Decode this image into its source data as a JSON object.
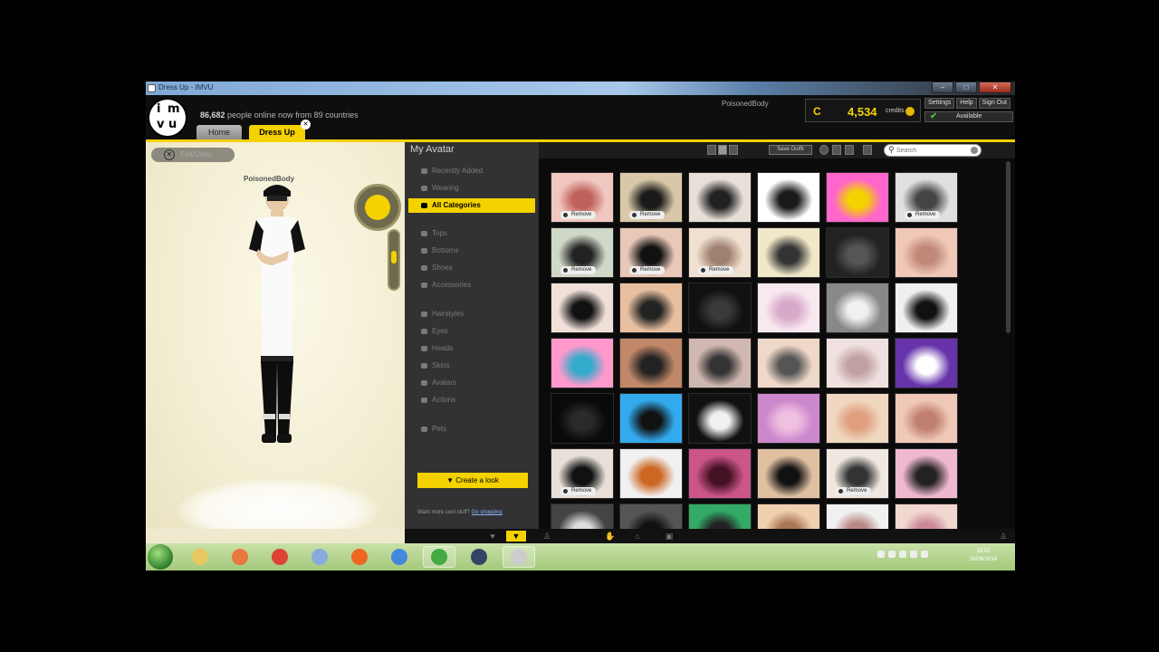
{
  "window": {
    "title": "Dress Up - IMVU"
  },
  "header": {
    "logo_letters": [
      "i",
      "m",
      "v",
      "u"
    ],
    "online_count": "86,682",
    "online_text": "people online now from 89 countries",
    "username": "PoisonedBody",
    "credits_value": "4,534",
    "credits_label": "credits",
    "links": [
      "Settings",
      "Help",
      "Sign Out"
    ],
    "status": "Available",
    "tabs": [
      {
        "label": "Home"
      },
      {
        "label": "Dress Up"
      }
    ],
    "accent_color": "#f3d200"
  },
  "avatar_view": {
    "back_label": "Exit/Undo",
    "avatar_name": "PoisonedBody"
  },
  "categories": {
    "title": "My Avatar",
    "items": [
      {
        "label": "Recently Added",
        "icon": "clock-icon"
      },
      {
        "label": "Wearing",
        "icon": "shirt-icon"
      },
      {
        "label": "All Categories",
        "icon": "grid-icon",
        "selected": true
      },
      {
        "label": "Tops",
        "icon": "shirt-icon"
      },
      {
        "label": "Bottoms",
        "icon": "pants-icon"
      },
      {
        "label": "Shoes",
        "icon": "shoe-icon"
      },
      {
        "label": "Accessories",
        "icon": "accessory-icon"
      },
      {
        "label": "Hairstyles",
        "icon": "hair-icon"
      },
      {
        "label": "Eyes",
        "icon": "eye-icon"
      },
      {
        "label": "Heads",
        "icon": "head-icon"
      },
      {
        "label": "Skins",
        "icon": "skin-icon"
      },
      {
        "label": "Avatars",
        "icon": "avatar-icon"
      },
      {
        "label": "Actions",
        "icon": "action-icon"
      },
      {
        "label": "Pets",
        "icon": "pet-icon"
      }
    ],
    "shop_note": "Want more cool stuff?",
    "shop_link": "Go shopping",
    "create_button": "Create a look"
  },
  "toolbar": {
    "save_outfit": "Save Outfit",
    "search_placeholder": "Search"
  },
  "products": {
    "remove_label": "Remove",
    "tiles": [
      {
        "colors": [
          "#f0c8c0",
          "#c0605a"
        ],
        "remove": true
      },
      {
        "colors": [
          "#d8c8a8",
          "#1a1a1a"
        ],
        "remove": true
      },
      {
        "colors": [
          "#e8e0d8",
          "#222222"
        ],
        "remove": false
      },
      {
        "colors": [
          "#ffffff",
          "#1a1a1a"
        ],
        "remove": false
      },
      {
        "colors": [
          "#ff66cc",
          "#f3d200"
        ],
        "remove": false
      },
      {
        "colors": [
          "#e0e0e0",
          "#444444"
        ],
        "remove": true
      },
      {
        "colors": [
          "#d0d8c8",
          "#222222"
        ],
        "remove": true
      },
      {
        "colors": [
          "#e8c8b8",
          "#111111"
        ],
        "remove": true
      },
      {
        "colors": [
          "#f0e0d0",
          "#a08070"
        ],
        "remove": true
      },
      {
        "colors": [
          "#f0e8c8",
          "#333333"
        ],
        "remove": false
      },
      {
        "colors": [
          "#222222",
          "#555555"
        ],
        "remove": false
      },
      {
        "colors": [
          "#f0c8b8",
          "#c08878"
        ],
        "remove": false
      },
      {
        "colors": [
          "#f0e0d8",
          "#111111"
        ],
        "remove": false
      },
      {
        "colors": [
          "#e8c0a0",
          "#222222"
        ],
        "remove": false
      },
      {
        "colors": [
          "#111111",
          "#3a3a3a"
        ],
        "remove": false
      },
      {
        "colors": [
          "#f8e8f0",
          "#d8a8c8"
        ],
        "remove": false
      },
      {
        "colors": [
          "#888888",
          "#f0f0f0"
        ],
        "remove": false
      },
      {
        "colors": [
          "#f0f0f0",
          "#111111"
        ],
        "remove": false
      },
      {
        "colors": [
          "#ff99cc",
          "#33aacc"
        ],
        "remove": false
      },
      {
        "colors": [
          "#c08868",
          "#222222"
        ],
        "remove": false
      },
      {
        "colors": [
          "#d0b8b0",
          "#333333"
        ],
        "remove": false
      },
      {
        "colors": [
          "#f0d8c8",
          "#555555"
        ],
        "remove": false
      },
      {
        "colors": [
          "#f0e0e0",
          "#c0a0a0"
        ],
        "remove": false
      },
      {
        "colors": [
          "#6633aa",
          "#ffffff"
        ],
        "remove": false
      },
      {
        "colors": [
          "#0a0a0a",
          "#2a2a2a"
        ],
        "remove": false
      },
      {
        "colors": [
          "#33aaee",
          "#111111"
        ],
        "remove": false
      },
      {
        "colors": [
          "#111111",
          "#f0f0f0"
        ],
        "remove": false
      },
      {
        "colors": [
          "#cc88cc",
          "#f0c0e0"
        ],
        "remove": false
      },
      {
        "colors": [
          "#f0d8c0",
          "#e0a080"
        ],
        "remove": false
      },
      {
        "colors": [
          "#f0c8b8",
          "#c08070"
        ],
        "remove": false
      },
      {
        "colors": [
          "#e8e0d8",
          "#111111"
        ],
        "remove": true
      },
      {
        "colors": [
          "#f0f0f0",
          "#cc6622"
        ],
        "remove": false
      },
      {
        "colors": [
          "#cc5588",
          "#441122"
        ],
        "remove": false
      },
      {
        "colors": [
          "#e0c0a0",
          "#111111"
        ],
        "remove": false
      },
      {
        "colors": [
          "#f0e8e0",
          "#333333"
        ],
        "remove": true
      },
      {
        "colors": [
          "#f0b8d0",
          "#222222"
        ],
        "remove": false
      },
      {
        "colors": [
          "#444444",
          "#dddddd"
        ],
        "remove": false
      },
      {
        "colors": [
          "#555555",
          "#111111"
        ],
        "remove": false
      },
      {
        "colors": [
          "#33aa66",
          "#222222"
        ],
        "remove": false
      },
      {
        "colors": [
          "#f0d0b0",
          "#aa7755"
        ],
        "remove": false
      },
      {
        "colors": [
          "#f0f0f0",
          "#bb8888"
        ],
        "remove": false
      },
      {
        "colors": [
          "#f0d8d0",
          "#cc8899"
        ],
        "remove": false
      }
    ]
  },
  "taskbar": {
    "apps": [
      {
        "icon": "folder-icon",
        "color": "#e8c860",
        "open": false
      },
      {
        "icon": "media-player-icon",
        "color": "#e87840",
        "open": false
      },
      {
        "icon": "chrome-icon",
        "color": "#dd4433",
        "open": false
      },
      {
        "icon": "network-icon",
        "color": "#88aadd",
        "open": false
      },
      {
        "icon": "media-icon",
        "color": "#ee6622",
        "open": false
      },
      {
        "icon": "search-icon",
        "color": "#4488dd",
        "open": false
      },
      {
        "icon": "chrome-icon",
        "color": "#44aa44",
        "open": true
      },
      {
        "icon": "globe-icon",
        "color": "#334466",
        "open": false
      },
      {
        "icon": "imvu-icon",
        "color": "#cccccc",
        "open": true
      }
    ],
    "clock_time": "18:02",
    "clock_date": "26/06/2014"
  }
}
